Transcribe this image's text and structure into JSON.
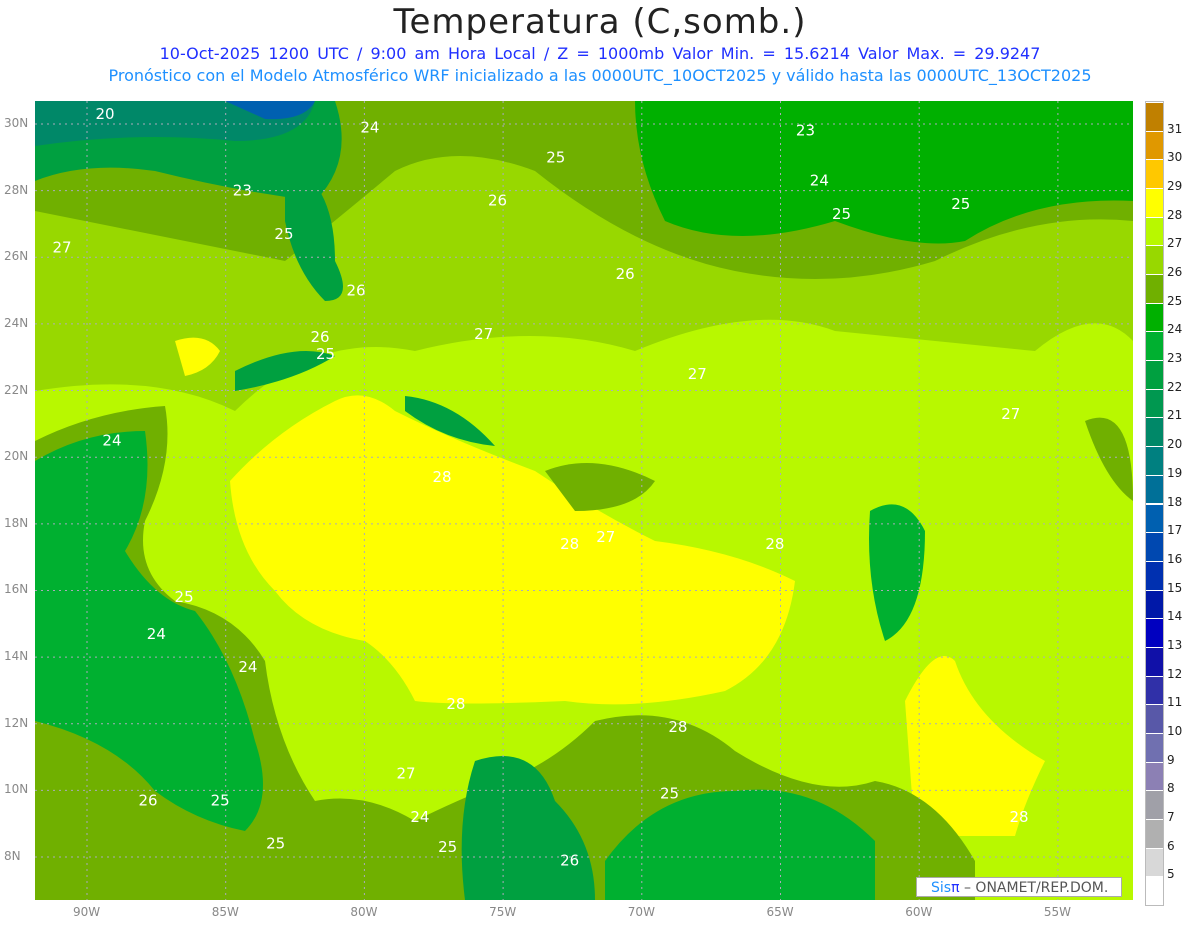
{
  "header": {
    "title": "Temperatura (C,somb.)",
    "subtitle1": "10-Oct-2025  1200 UTC / 9:00 am Hora Local / Z = 1000mb   Valor Min. = 15.6214  Valor Max. = 29.9247",
    "subtitle2": "Pronóstico con el Modelo Atmosférico WRF inicializado a las 0000UTC_10OCT2025 y válido hasta las  0000UTC_13OCT2025"
  },
  "axes": {
    "lat_ticks": [
      "30N",
      "28N",
      "26N",
      "24N",
      "22N",
      "20N",
      "18N",
      "16N",
      "14N",
      "12N",
      "10N",
      "8N"
    ],
    "lon_ticks": [
      "90W",
      "85W",
      "80W",
      "75W",
      "70W",
      "65W",
      "60W",
      "55W"
    ]
  },
  "colorbar": {
    "labels": [
      "5",
      "6",
      "7",
      "8",
      "9",
      "10",
      "11",
      "12",
      "13",
      "14",
      "15",
      "16",
      "17",
      "18",
      "19",
      "20",
      "21",
      "22",
      "23",
      "24",
      "25",
      "26",
      "27",
      "28",
      "29",
      "30",
      "31"
    ],
    "colors": [
      "#ffffff",
      "#d8d8d8",
      "#b0b0b0",
      "#a0a0a8",
      "#8c80b4",
      "#7070b0",
      "#5858a8",
      "#3030a8",
      "#1010a8",
      "#0000c0",
      "#0018a8",
      "#0030b0",
      "#0048b0",
      "#0060b0",
      "#007098",
      "#008080",
      "#008868",
      "#009850",
      "#00a040",
      "#00b030",
      "#00b000",
      "#70b000",
      "#98d800",
      "#b8f800",
      "#ffff00",
      "#ffc800",
      "#e09800",
      "#c08000"
    ]
  },
  "contour_labels": [
    {
      "t": "20",
      "lon": -89.35,
      "lat": 30.3
    },
    {
      "t": "24",
      "lon": -79.8,
      "lat": 29.9
    },
    {
      "t": "23",
      "lon": -64.1,
      "lat": 29.8
    },
    {
      "t": "25",
      "lon": -73.1,
      "lat": 29.0
    },
    {
      "t": "26",
      "lon": -75.2,
      "lat": 27.7
    },
    {
      "t": "24",
      "lon": -63.6,
      "lat": 28.3
    },
    {
      "t": "23",
      "lon": -84.4,
      "lat": 28.0
    },
    {
      "t": "25",
      "lon": -62.8,
      "lat": 27.3
    },
    {
      "t": "25",
      "lon": -58.5,
      "lat": 27.6
    },
    {
      "t": "25",
      "lon": -82.9,
      "lat": 26.7
    },
    {
      "t": "27",
      "lon": -90.9,
      "lat": 26.3
    },
    {
      "t": "26",
      "lon": -70.6,
      "lat": 25.5
    },
    {
      "t": "26",
      "lon": -80.3,
      "lat": 25.0
    },
    {
      "t": "26",
      "lon": -81.6,
      "lat": 23.6
    },
    {
      "t": "25",
      "lon": -81.4,
      "lat": 23.1
    },
    {
      "t": "27",
      "lon": -75.7,
      "lat": 23.7
    },
    {
      "t": "27",
      "lon": -68.0,
      "lat": 22.5
    },
    {
      "t": "27",
      "lon": -56.7,
      "lat": 21.3
    },
    {
      "t": "24",
      "lon": -89.1,
      "lat": 20.5
    },
    {
      "t": "28",
      "lon": -77.2,
      "lat": 19.4
    },
    {
      "t": "28",
      "lon": -72.6,
      "lat": 17.4
    },
    {
      "t": "27",
      "lon": -71.3,
      "lat": 17.6
    },
    {
      "t": "28",
      "lon": -65.2,
      "lat": 17.4
    },
    {
      "t": "25",
      "lon": -86.5,
      "lat": 15.8
    },
    {
      "t": "24",
      "lon": -87.5,
      "lat": 14.7
    },
    {
      "t": "24",
      "lon": -84.2,
      "lat": 13.7
    },
    {
      "t": "28",
      "lon": -76.7,
      "lat": 12.6
    },
    {
      "t": "28",
      "lon": -68.7,
      "lat": 11.9
    },
    {
      "t": "27",
      "lon": -78.5,
      "lat": 10.5
    },
    {
      "t": "26",
      "lon": -87.8,
      "lat": 9.7
    },
    {
      "t": "25",
      "lon": -85.2,
      "lat": 9.7
    },
    {
      "t": "25",
      "lon": -69.0,
      "lat": 9.9
    },
    {
      "t": "24",
      "lon": -78.0,
      "lat": 9.2
    },
    {
      "t": "25",
      "lon": -83.2,
      "lat": 8.4
    },
    {
      "t": "25",
      "lon": -77.0,
      "lat": 8.3
    },
    {
      "t": "26",
      "lon": -72.6,
      "lat": 7.9
    },
    {
      "t": "28",
      "lon": -56.4,
      "lat": 9.2
    }
  ],
  "credit": {
    "logo_a": "Sis",
    "logo_b": "π",
    "text": "– ONAMET/REP.DOM."
  }
}
